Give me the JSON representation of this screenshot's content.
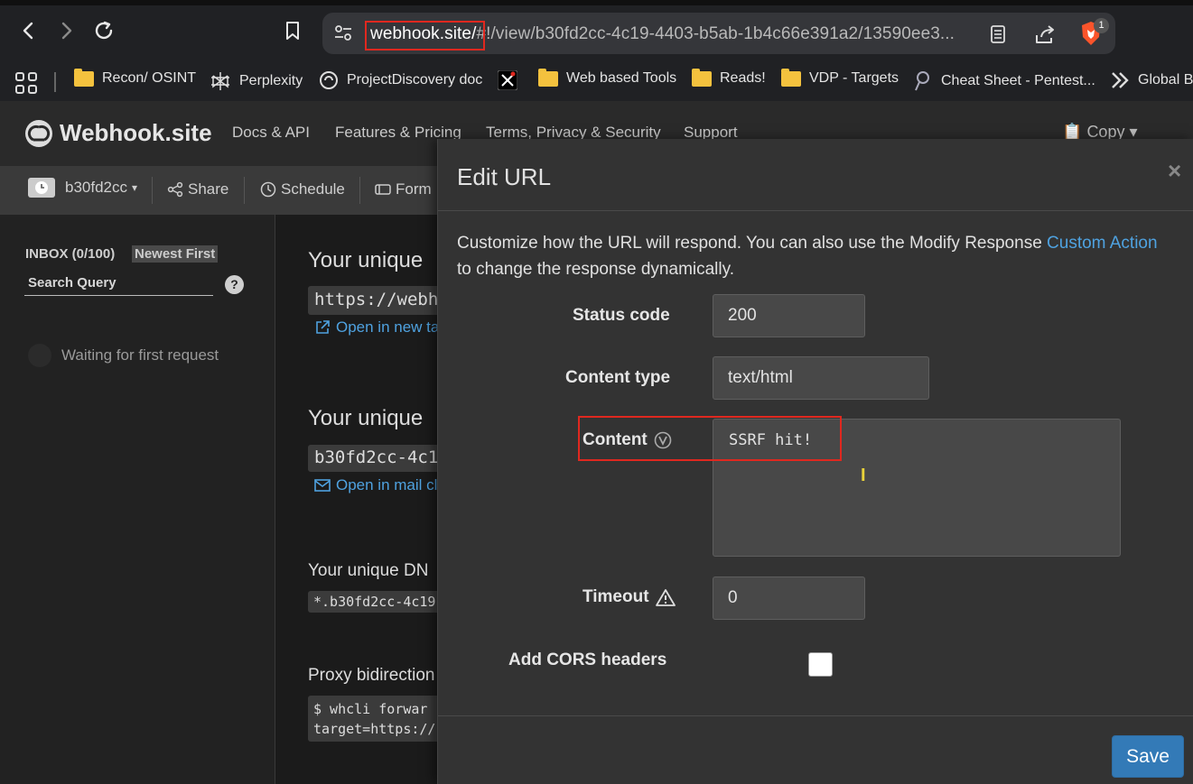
{
  "browser": {
    "url_host": "webhook.site/",
    "url_path": "#!/view/b30fd2cc-4c19-4403-b5ab-1b4c66e391a2/13590ee3...",
    "brave_badge": "1",
    "bookmarks": [
      {
        "label": "Recon/ OSINT",
        "icon": "folder-icon"
      },
      {
        "label": "Perplexity",
        "icon": "perplexity-icon"
      },
      {
        "label": "ProjectDiscovery doc",
        "icon": "projectdiscovery-icon"
      },
      {
        "label": "",
        "icon": "x-icon"
      },
      {
        "label": "Web based Tools",
        "icon": "folder-icon"
      },
      {
        "label": "Reads!",
        "icon": "folder-icon"
      },
      {
        "label": "VDP - Targets",
        "icon": "folder-icon"
      },
      {
        "label": "Cheat Sheet - Pentest...",
        "icon": "cheatsheet-icon"
      },
      {
        "label": "Global Bu",
        "icon": "global-icon"
      }
    ]
  },
  "app": {
    "logo": "Webhook.site",
    "nav": [
      "Docs & API",
      "Features & Pricing",
      "Terms, Privacy & Security",
      "Support"
    ],
    "copy_menu": "Copy",
    "toolbar": {
      "token": "b30fd2cc",
      "share": "Share",
      "schedule": "Schedule",
      "form": "Form"
    }
  },
  "sidebar": {
    "inbox": "INBOX (0/100)",
    "sort": "Newest First",
    "search_placeholder": "Search Query",
    "help": "?",
    "waiting": "Waiting for first request"
  },
  "main": {
    "url_heading": "Your unique",
    "url_value": "https://webh",
    "open_new_tab": "Open in new ta",
    "email_heading": "Your unique",
    "email_value": "b30fd2cc-4c1",
    "open_mail": "Open in mail cl",
    "dns_heading": "Your unique DN",
    "dns_value": "*.b30fd2cc-4c19",
    "proxy_heading": "Proxy bidirection",
    "proxy_line1": "$ whcli forwar",
    "proxy_line2": "target=https://"
  },
  "modal": {
    "title": "Edit URL",
    "close": "×",
    "description_before": "Customize how the URL will respond. You can also use the Modify Response ",
    "description_link": "Custom Action",
    "description_after": " to change the response dynamically.",
    "status_label": "Status code",
    "status_value": "200",
    "content_type_label": "Content type",
    "content_type_value": "text/html",
    "content_label": "Content",
    "content_value": "SSRF hit!",
    "timeout_label": "Timeout",
    "timeout_value": "0",
    "cors_label": "Add CORS headers",
    "cors_checked": false,
    "save": "Save"
  }
}
